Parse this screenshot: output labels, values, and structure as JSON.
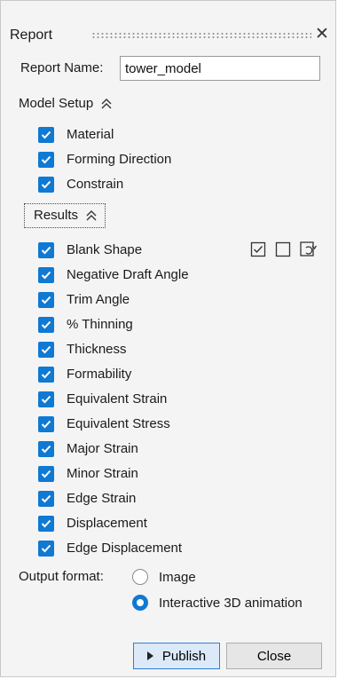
{
  "window": {
    "title": "Report",
    "close_glyph": "✕"
  },
  "report_name": {
    "label": "Report Name:",
    "value": "tower_model"
  },
  "model_setup": {
    "header": "Model Setup",
    "items": [
      {
        "label": "Material",
        "checked": true
      },
      {
        "label": "Forming Direction",
        "checked": true
      },
      {
        "label": "Constrain",
        "checked": true
      }
    ]
  },
  "results": {
    "header": "Results",
    "toolbar_icons": [
      "check-all-icon",
      "uncheck-all-icon",
      "invert-selection-icon"
    ],
    "items": [
      {
        "label": "Blank Shape",
        "checked": true
      },
      {
        "label": "Negative Draft Angle",
        "checked": true
      },
      {
        "label": "Trim Angle",
        "checked": true
      },
      {
        "label": "% Thinning",
        "checked": true
      },
      {
        "label": "Thickness",
        "checked": true
      },
      {
        "label": "Formability",
        "checked": true
      },
      {
        "label": "Equivalent Strain",
        "checked": true
      },
      {
        "label": "Equivalent Stress",
        "checked": true
      },
      {
        "label": "Major Strain",
        "checked": true
      },
      {
        "label": "Minor Strain",
        "checked": true
      },
      {
        "label": "Edge Strain",
        "checked": true
      },
      {
        "label": "Displacement",
        "checked": true
      },
      {
        "label": "Edge Displacement",
        "checked": true
      }
    ]
  },
  "output_format": {
    "label": "Output format:",
    "options": [
      {
        "label": "Image",
        "selected": false
      },
      {
        "label": "Interactive 3D animation",
        "selected": true
      }
    ]
  },
  "buttons": {
    "publish": "Publish",
    "close": "Close"
  },
  "colors": {
    "accent": "#0f79d3",
    "panel_bg": "#f4f4f4",
    "publish_bg": "#dbe9f8",
    "publish_border": "#2f7fd6"
  }
}
